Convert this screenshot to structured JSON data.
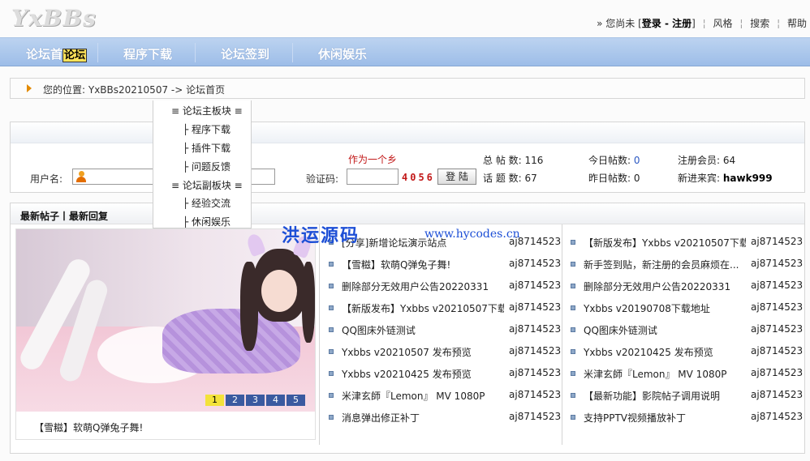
{
  "header": {
    "logo_text": "YxBBs",
    "prefix": "» 您尚未 [",
    "login": "登录",
    "dash": " - ",
    "register": "注册",
    "suffix": "]",
    "links": [
      "风格",
      "搜索",
      "帮助"
    ]
  },
  "nav": {
    "items": [
      "论坛首",
      "程序下载",
      "论坛签到",
      "休闲娱乐"
    ],
    "highlight": "论坛"
  },
  "breadcrumb": {
    "text": "您的位置: YxBBs20210507 -> 论坛首页"
  },
  "login": {
    "username_label": "用户名:",
    "captcha_label": "验证码:",
    "captcha_code": "4056",
    "captcha_note": "作为一个乡",
    "login_button": "登 陆"
  },
  "stats": {
    "total_posts_label": "总 帖 数:",
    "total_posts": "116",
    "topics_label": "话 题 数:",
    "topics": "67",
    "today_label": "今日帖数:",
    "today": "0",
    "yesterday_label": "昨日帖数:",
    "yesterday": "0",
    "members_label": "注册会员:",
    "members": "64",
    "newest_label": "新进来宾:",
    "newest": "hawk999"
  },
  "dropdown": {
    "items": [
      "≡ 论坛主板块 ≡",
      "├ 程序下载",
      "├ 插件下载",
      "├ 问题反馈",
      "≡ 论坛副板块 ≡",
      "├ 经验交流",
      "├ 休闲娱乐"
    ]
  },
  "latest": {
    "title": "最新帖子丨最新回复",
    "watermark": "洪运源码",
    "watermark_url": "www.hycodes.cn",
    "caption": "【雪糍】软萌Q弹兔子舞!",
    "pager": [
      "1",
      "2",
      "3",
      "4",
      "5"
    ],
    "col1": [
      {
        "title": "[分享]新增论坛演示站点",
        "author": "aj8714523"
      },
      {
        "title": "【雪糍】软萌Q弹兔子舞!",
        "author": "aj8714523"
      },
      {
        "title": "删除部分无效用户公告20220331",
        "author": "aj8714523"
      },
      {
        "title": "【新版发布】Yxbbs v20210507下载...",
        "author": "aj8714523"
      },
      {
        "title": "QQ图床外链测试",
        "author": "aj8714523"
      },
      {
        "title": "Yxbbs v20210507 发布预览",
        "author": "aj8714523"
      },
      {
        "title": "Yxbbs v20210425 发布预览",
        "author": "aj8714523"
      },
      {
        "title": "米津玄師『Lemon』 MV 1080P",
        "author": "aj8714523"
      },
      {
        "title": "消息弹出修正补丁",
        "author": "aj8714523"
      }
    ],
    "col2": [
      {
        "title": "【新版发布】Yxbbs v20210507下载...",
        "author": "aj8714523"
      },
      {
        "title": "新手签到贴，新注册的会员麻烦在...",
        "author": "aj8714523"
      },
      {
        "title": "删除部分无效用户公告20220331",
        "author": "aj8714523"
      },
      {
        "title": "Yxbbs v20190708下载地址",
        "author": "aj8714523"
      },
      {
        "title": "QQ图床外链测试",
        "author": "aj8714523"
      },
      {
        "title": "Yxbbs v20210425 发布预览",
        "author": "aj8714523"
      },
      {
        "title": "米津玄師『Lemon』 MV 1080P",
        "author": "aj8714523"
      },
      {
        "title": "【最新功能】影院帖子调用说明",
        "author": "aj8714523"
      },
      {
        "title": "支持PPTV视频播放补丁",
        "author": "aj8714523"
      }
    ]
  }
}
